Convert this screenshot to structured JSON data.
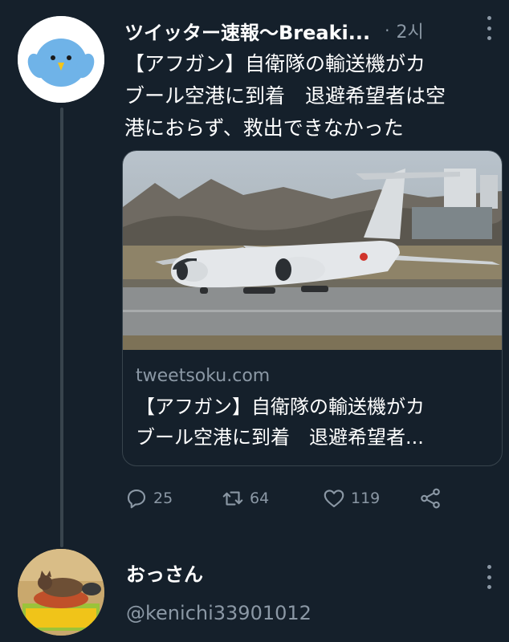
{
  "tweet": {
    "display_name": "ツイッター速報〜Breaki...",
    "separator": "·",
    "time": "2시",
    "text_lines": [
      "【アフガン】自衛隊の輸送機がカ",
      "ブール空港に到着　退避希望者は空",
      "港におらず、救出できなかった"
    ],
    "card": {
      "domain": "tweetsoku.com",
      "title_lines": [
        "【アフガン】自衛隊の輸送機がカ",
        "ブール空港に到着　退避希望者..."
      ],
      "image_icon": "transport-aircraft-photo"
    },
    "actions": {
      "reply_count": "25",
      "retweet_count": "64",
      "like_count": "119"
    },
    "avatar_icon": "bluebird-avatar"
  },
  "reply": {
    "display_name": "おっさん",
    "handle": "@kenichi33901012",
    "avatar_icon": "cat-avatar"
  },
  "colors": {
    "background": "#15202b",
    "muted_text": "#8b98a5",
    "border": "#38444d",
    "avatar_bird": "#6fb3e8"
  }
}
